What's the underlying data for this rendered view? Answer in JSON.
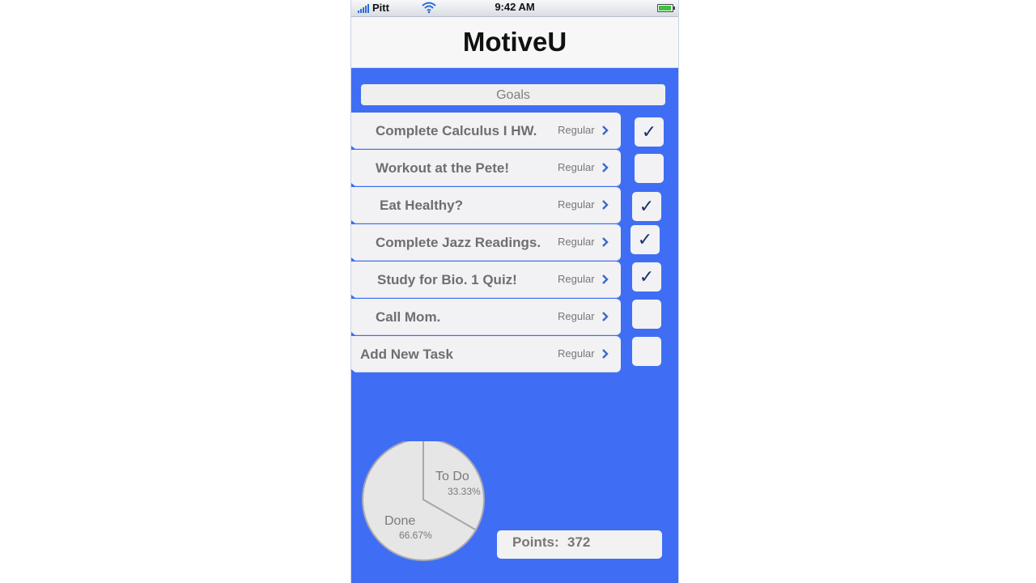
{
  "status_bar": {
    "carrier": "Pitt",
    "time": "9:42 AM"
  },
  "app": {
    "title": "MotiveU"
  },
  "goals": {
    "label": "Goals"
  },
  "tasks": [
    {
      "label": "Complete Calculus I HW.",
      "tag": "Regular",
      "checked": true
    },
    {
      "label": "Workout at the Pete!",
      "tag": "Regular",
      "checked": false
    },
    {
      "label": "Eat Healthy?",
      "tag": "Regular",
      "checked": true
    },
    {
      "label": "Complete Jazz Readings.",
      "tag": "Regular",
      "checked": true
    },
    {
      "label": "Study for Bio. 1 Quiz!",
      "tag": "Regular",
      "checked": true
    },
    {
      "label": "Call Mom.",
      "tag": "Regular",
      "checked": false
    },
    {
      "label": "Add New Task",
      "tag": "Regular",
      "checked": false
    }
  ],
  "checkmark_glyph": "✓",
  "chart_data": {
    "type": "pie",
    "slices": [
      {
        "label": "To Do",
        "value": 33.33,
        "value_label": "33.33%"
      },
      {
        "label": "Done",
        "value": 66.67,
        "value_label": "66.67%"
      }
    ]
  },
  "points": {
    "label": "Points:",
    "value": "372"
  },
  "colors": {
    "background": "#3f6ef4",
    "check": "#1c2f6e",
    "chevron": "#3d68c8"
  },
  "icons": {
    "signal": "signal-icon",
    "wifi": "wifi-icon",
    "battery": "battery-icon",
    "chevron": "chevron-right-icon"
  }
}
